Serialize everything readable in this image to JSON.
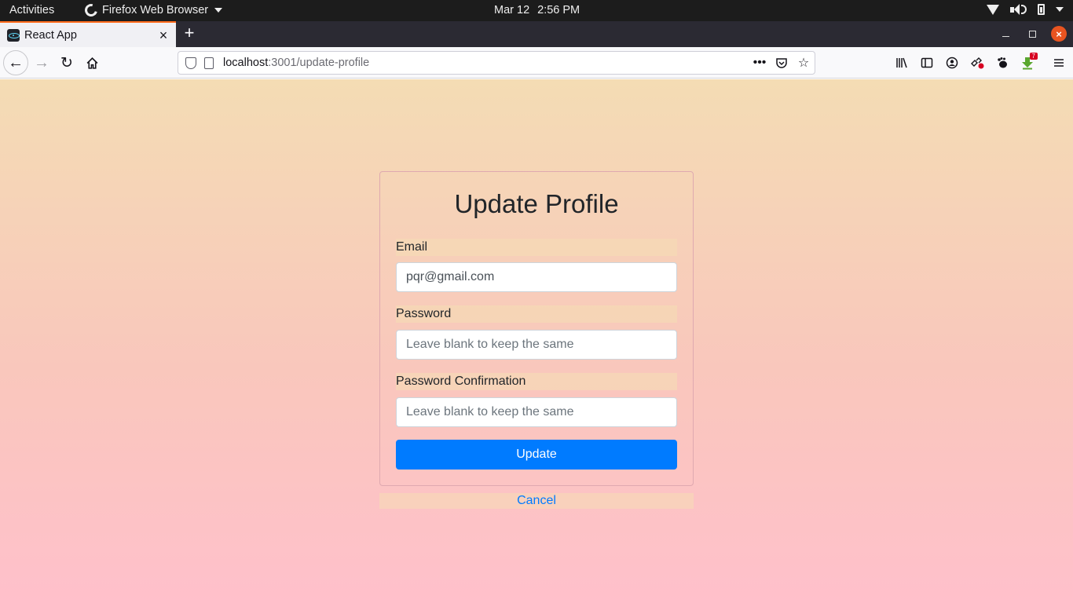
{
  "system_bar": {
    "activities": "Activities",
    "app_name": "Firefox Web Browser",
    "date": "Mar 12",
    "time": "2:56 PM"
  },
  "browser": {
    "tab_title": "React App",
    "url_host": "localhost",
    "url_path": ":3001/update-profile",
    "downloads_badge": "7"
  },
  "page": {
    "title": "Update Profile",
    "email_label": "Email",
    "email_value": "pqr@gmail.com",
    "password_label": "Password",
    "password_placeholder": "Leave blank to keep the same",
    "password_confirmation_label": "Password Confirmation",
    "password_confirmation_placeholder": "Leave blank to keep the same",
    "update_button": "Update",
    "cancel_link": "Cancel"
  },
  "colors": {
    "primary": "#007bff",
    "gradient_top": "#f4dcb4",
    "gradient_bottom": "#ffc0cb"
  }
}
